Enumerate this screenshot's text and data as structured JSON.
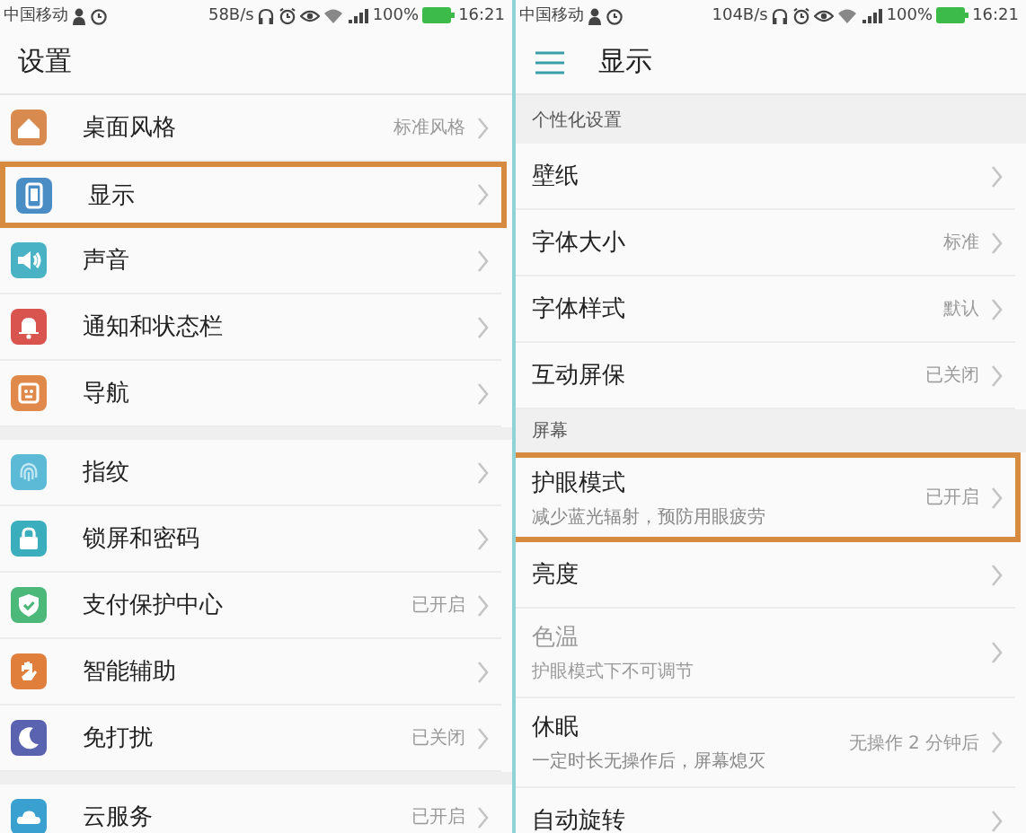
{
  "screens": [
    {
      "status_bar": {
        "carrier": "中国移动",
        "speed": "58B/s",
        "battery": "100%",
        "time": "16:21"
      },
      "header": {
        "title": "设置",
        "menu": false
      },
      "sections": [
        {
          "items": [
            {
              "label": "桌面风格",
              "value": "标准风格",
              "color": "#d98a4e",
              "highlighted": false
            },
            {
              "label": "显示",
              "color": "#4a8cc4",
              "highlighted": true
            },
            {
              "label": "声音",
              "color": "#49b2c4",
              "highlighted": false
            },
            {
              "label": "通知和状态栏",
              "color": "#d9544f",
              "highlighted": false
            },
            {
              "label": "导航",
              "color": "#e0894a",
              "highlighted": false
            }
          ]
        },
        {
          "items": [
            {
              "label": "指纹",
              "color": "#5cbad6",
              "highlighted": false
            },
            {
              "label": "锁屏和密码",
              "color": "#3aaebc",
              "highlighted": false
            },
            {
              "label": "支付保护中心",
              "value": "已开启",
              "color": "#4cb87a",
              "highlighted": false
            },
            {
              "label": "智能辅助",
              "color": "#e07f3c",
              "highlighted": false
            },
            {
              "label": "免打扰",
              "value": "已关闭",
              "color": "#5a63b0",
              "highlighted": false
            }
          ]
        },
        {
          "items": [
            {
              "label": "云服务",
              "value": "已开启",
              "color": "#3aa0d0",
              "highlighted": false
            }
          ]
        }
      ]
    },
    {
      "status_bar": {
        "carrier": "中国移动",
        "speed": "104B/s",
        "battery": "100%",
        "time": "16:21"
      },
      "header": {
        "title": "显示",
        "menu": true
      },
      "sections": [
        {
          "title": "个性化设置",
          "items": [
            {
              "label": "壁纸",
              "highlighted": false,
              "disabled": false
            },
            {
              "label": "字体大小",
              "value": "标准",
              "highlighted": false,
              "disabled": false
            },
            {
              "label": "字体样式",
              "value": "默认",
              "highlighted": false,
              "disabled": false
            },
            {
              "label": "互动屏保",
              "value": "已关闭",
              "highlighted": false,
              "disabled": false
            }
          ]
        },
        {
          "title": "屏幕",
          "items": [
            {
              "label": "护眼模式",
              "subtitle": "减少蓝光辐射，预防用眼疲劳",
              "value": "已开启",
              "highlighted": true,
              "disabled": false
            },
            {
              "label": "亮度",
              "highlighted": false,
              "disabled": false
            },
            {
              "label": "色温",
              "subtitle": "护眼模式下不可调节",
              "highlighted": false,
              "disabled": true
            },
            {
              "label": "休眠",
              "subtitle": "一定时长无操作后，屏幕熄灭",
              "value": "无操作 2 分钟后",
              "highlighted": false,
              "disabled": false
            },
            {
              "label": "自动旋转",
              "highlighted": false,
              "disabled": false
            }
          ]
        }
      ]
    }
  ]
}
